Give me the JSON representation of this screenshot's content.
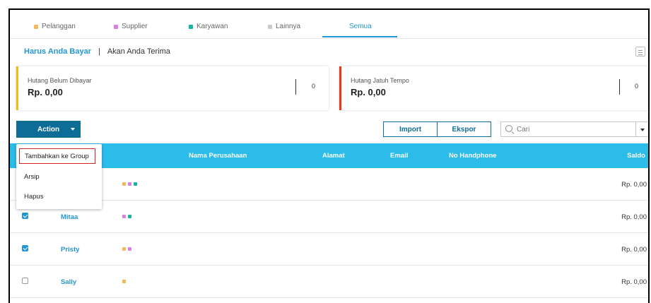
{
  "colors": {
    "pelanggan": "#f5b65b",
    "supplier": "#dd7ce3",
    "karyawan": "#14b5a4",
    "lainnya": "#c9c9c9",
    "accent": "#2196d3",
    "action": "#0e6d97",
    "header": "#2bbcea",
    "card1_bar": "#f5b915",
    "card2_bar": "#e33b17"
  },
  "tabs": [
    {
      "label": "Pelanggan",
      "color": "#f5b65b"
    },
    {
      "label": "Supplier",
      "color": "#dd7ce3"
    },
    {
      "label": "Karyawan",
      "color": "#14b5a4"
    },
    {
      "label": "Lainnya",
      "color": "#c9c9c9"
    },
    {
      "label": "Semua",
      "active": true
    }
  ],
  "subnav": {
    "primary": "Harus Anda Bayar",
    "separator": "|",
    "secondary": "Akan Anda Terima"
  },
  "cards": [
    {
      "label": "Hutang Belum Dibayar",
      "value": "Rp. 0,00",
      "count": "0"
    },
    {
      "label": "Hutang Jatuh Tempo",
      "value": "Rp. 0,00",
      "count": "0"
    }
  ],
  "toolbar": {
    "action_label": "Action",
    "import_label": "Import",
    "export_label": "Ekspor",
    "search_placeholder": "Cari"
  },
  "table": {
    "columns": [
      "Nama Perusahaan",
      "Alamat",
      "Email",
      "No Handphone",
      "Saldo"
    ],
    "rows": [
      {
        "checked": false,
        "name": "",
        "dots": [
          "#f5b65b",
          "#dd7ce3",
          "#14b5a4"
        ],
        "saldo": "Rp. 0,00"
      },
      {
        "checked": true,
        "name": "Mitaa",
        "dots": [
          "#dd7ce3",
          "#14b5a4"
        ],
        "saldo": "Rp. 0,00"
      },
      {
        "checked": true,
        "name": "Pristy",
        "dots": [
          "#f5b65b",
          "#dd7ce3"
        ],
        "saldo": "Rp. 0,00"
      },
      {
        "checked": false,
        "name": "Sally",
        "dots": [
          "#f5b65b"
        ],
        "saldo": "Rp. 0,00"
      }
    ]
  },
  "menu": {
    "items": [
      "Tambahkan ke Group",
      "Arsip",
      "Hapus"
    ]
  }
}
